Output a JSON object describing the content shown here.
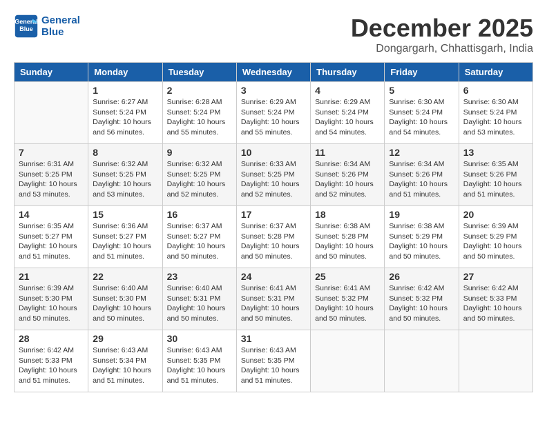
{
  "header": {
    "logo_line1": "General",
    "logo_line2": "Blue",
    "month_title": "December 2025",
    "subtitle": "Dongargarh, Chhattisgarh, India"
  },
  "days_of_week": [
    "Sunday",
    "Monday",
    "Tuesday",
    "Wednesday",
    "Thursday",
    "Friday",
    "Saturday"
  ],
  "weeks": [
    [
      {
        "day": "",
        "info": ""
      },
      {
        "day": "1",
        "info": "Sunrise: 6:27 AM\nSunset: 5:24 PM\nDaylight: 10 hours\nand 56 minutes."
      },
      {
        "day": "2",
        "info": "Sunrise: 6:28 AM\nSunset: 5:24 PM\nDaylight: 10 hours\nand 55 minutes."
      },
      {
        "day": "3",
        "info": "Sunrise: 6:29 AM\nSunset: 5:24 PM\nDaylight: 10 hours\nand 55 minutes."
      },
      {
        "day": "4",
        "info": "Sunrise: 6:29 AM\nSunset: 5:24 PM\nDaylight: 10 hours\nand 54 minutes."
      },
      {
        "day": "5",
        "info": "Sunrise: 6:30 AM\nSunset: 5:24 PM\nDaylight: 10 hours\nand 54 minutes."
      },
      {
        "day": "6",
        "info": "Sunrise: 6:30 AM\nSunset: 5:24 PM\nDaylight: 10 hours\nand 53 minutes."
      }
    ],
    [
      {
        "day": "7",
        "info": "Sunrise: 6:31 AM\nSunset: 5:25 PM\nDaylight: 10 hours\nand 53 minutes."
      },
      {
        "day": "8",
        "info": "Sunrise: 6:32 AM\nSunset: 5:25 PM\nDaylight: 10 hours\nand 53 minutes."
      },
      {
        "day": "9",
        "info": "Sunrise: 6:32 AM\nSunset: 5:25 PM\nDaylight: 10 hours\nand 52 minutes."
      },
      {
        "day": "10",
        "info": "Sunrise: 6:33 AM\nSunset: 5:25 PM\nDaylight: 10 hours\nand 52 minutes."
      },
      {
        "day": "11",
        "info": "Sunrise: 6:34 AM\nSunset: 5:26 PM\nDaylight: 10 hours\nand 52 minutes."
      },
      {
        "day": "12",
        "info": "Sunrise: 6:34 AM\nSunset: 5:26 PM\nDaylight: 10 hours\nand 51 minutes."
      },
      {
        "day": "13",
        "info": "Sunrise: 6:35 AM\nSunset: 5:26 PM\nDaylight: 10 hours\nand 51 minutes."
      }
    ],
    [
      {
        "day": "14",
        "info": "Sunrise: 6:35 AM\nSunset: 5:27 PM\nDaylight: 10 hours\nand 51 minutes."
      },
      {
        "day": "15",
        "info": "Sunrise: 6:36 AM\nSunset: 5:27 PM\nDaylight: 10 hours\nand 51 minutes."
      },
      {
        "day": "16",
        "info": "Sunrise: 6:37 AM\nSunset: 5:27 PM\nDaylight: 10 hours\nand 50 minutes."
      },
      {
        "day": "17",
        "info": "Sunrise: 6:37 AM\nSunset: 5:28 PM\nDaylight: 10 hours\nand 50 minutes."
      },
      {
        "day": "18",
        "info": "Sunrise: 6:38 AM\nSunset: 5:28 PM\nDaylight: 10 hours\nand 50 minutes."
      },
      {
        "day": "19",
        "info": "Sunrise: 6:38 AM\nSunset: 5:29 PM\nDaylight: 10 hours\nand 50 minutes."
      },
      {
        "day": "20",
        "info": "Sunrise: 6:39 AM\nSunset: 5:29 PM\nDaylight: 10 hours\nand 50 minutes."
      }
    ],
    [
      {
        "day": "21",
        "info": "Sunrise: 6:39 AM\nSunset: 5:30 PM\nDaylight: 10 hours\nand 50 minutes."
      },
      {
        "day": "22",
        "info": "Sunrise: 6:40 AM\nSunset: 5:30 PM\nDaylight: 10 hours\nand 50 minutes."
      },
      {
        "day": "23",
        "info": "Sunrise: 6:40 AM\nSunset: 5:31 PM\nDaylight: 10 hours\nand 50 minutes."
      },
      {
        "day": "24",
        "info": "Sunrise: 6:41 AM\nSunset: 5:31 PM\nDaylight: 10 hours\nand 50 minutes."
      },
      {
        "day": "25",
        "info": "Sunrise: 6:41 AM\nSunset: 5:32 PM\nDaylight: 10 hours\nand 50 minutes."
      },
      {
        "day": "26",
        "info": "Sunrise: 6:42 AM\nSunset: 5:32 PM\nDaylight: 10 hours\nand 50 minutes."
      },
      {
        "day": "27",
        "info": "Sunrise: 6:42 AM\nSunset: 5:33 PM\nDaylight: 10 hours\nand 50 minutes."
      }
    ],
    [
      {
        "day": "28",
        "info": "Sunrise: 6:42 AM\nSunset: 5:33 PM\nDaylight: 10 hours\nand 51 minutes."
      },
      {
        "day": "29",
        "info": "Sunrise: 6:43 AM\nSunset: 5:34 PM\nDaylight: 10 hours\nand 51 minutes."
      },
      {
        "day": "30",
        "info": "Sunrise: 6:43 AM\nSunset: 5:35 PM\nDaylight: 10 hours\nand 51 minutes."
      },
      {
        "day": "31",
        "info": "Sunrise: 6:43 AM\nSunset: 5:35 PM\nDaylight: 10 hours\nand 51 minutes."
      },
      {
        "day": "",
        "info": ""
      },
      {
        "day": "",
        "info": ""
      },
      {
        "day": "",
        "info": ""
      }
    ]
  ]
}
